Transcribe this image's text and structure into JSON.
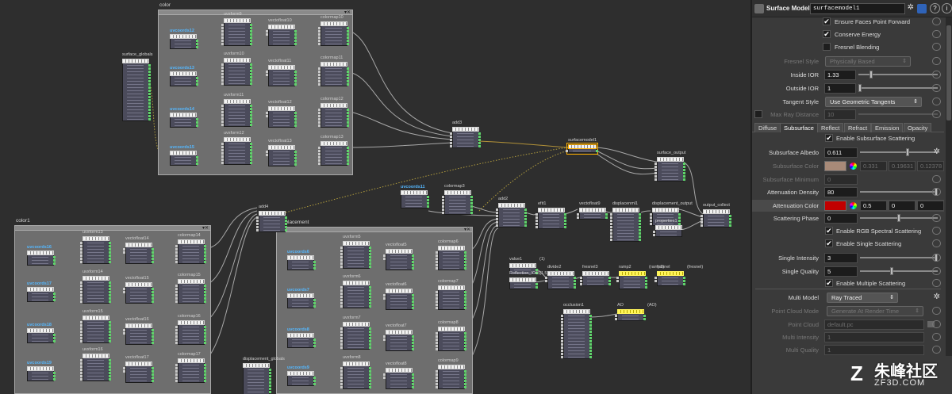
{
  "network": {
    "boxes": {
      "color": "color",
      "color1": "color1",
      "displacement": "Displacement",
      "box_ctl": "▾✕"
    },
    "nodes": {
      "uvcoords12": "uvcoords12",
      "uvxform9": "uvxform9",
      "vectofloat10": "vectofloat10",
      "colormap10": "colormap10",
      "uvcoords13": "uvcoords13",
      "uvxform10": "uvxform10",
      "vectofloat11": "vectofloat11",
      "colormap11": "colormap11",
      "uvcoords14": "uvcoords14",
      "uvxform11": "uvxform11",
      "vectofloat12": "vectofloat12",
      "colormap12": "colormap12",
      "uvcoords15": "uvcoords15",
      "uvxform12": "uvxform12",
      "vectofloat13": "vectofloat13",
      "colormap13": "colormap13",
      "surface_globals": "surface_globals",
      "add3": "add3",
      "add4": "add4",
      "surfacemodel1": "surfacemodel1",
      "surface_output": "surface_output",
      "uvcoords11": "uvcoords11",
      "colormap3": "colormap3",
      "add2": "add2",
      "efit1": "efit1",
      "vectofloat9": "vectofloat9",
      "displacenml1": "displacenml1",
      "displacement_output": "displacement_output",
      "properties1": "properties1",
      "output_collect": "output_collect",
      "value1": "value1",
      "value1_tag": "(1)",
      "refl": "Reflection_IOR1",
      "refl_tag": "(1.5)",
      "divide2": "divide2",
      "fresnel3": "fresnel3",
      "ramp2": "ramp2",
      "ramp2_tag": "(ramp2)",
      "fresnel": "fresnel",
      "fresnel_tag": "(fresnel)",
      "occlusion1": "occlusion1",
      "ao": "AO",
      "ao_tag": "(AO)",
      "uvcoords16": "uvcoords16",
      "uvxform13": "uvxform13",
      "vectofloat14": "vectofloat14",
      "colormap14": "colormap14",
      "uvcoords17": "uvcoords17",
      "uvxform14": "uvxform14",
      "vectofloat15": "vectofloat15",
      "colormap15": "colormap15",
      "uvcoords18": "uvcoords18",
      "uvxform15": "uvxform15",
      "vectofloat16": "vectofloat16",
      "colormap16": "colormap16",
      "uvcoords19": "uvcoords19",
      "uvxform16": "uvxform16",
      "vectofloat17": "vectofloat17",
      "colormap17": "colormap17",
      "uvcoords6": "uvcoords6",
      "uvxform5": "uvxform5",
      "vectofloat5": "vectofloat5",
      "colormap6": "colormap6",
      "uvcoords7": "uvcoords7",
      "uvxform6": "uvxform6",
      "vectofloat6": "vectofloat6",
      "colormap7": "colormap7",
      "uvcoords8": "uvcoords8",
      "uvxform7": "uvxform7",
      "vectofloat7": "vectofloat7",
      "colormap8": "colormap8",
      "uvcoords9": "uvcoords9",
      "uvxform8": "uvxform8",
      "vectofloat8": "vectofloat8",
      "colormap9": "colormap9",
      "displacement_globals": "displacement_globals"
    }
  },
  "panel": {
    "header": {
      "title": "Surface Model",
      "name": "surfacemodel1",
      "help": "?",
      "info": "i"
    },
    "ensure_faces": "Ensure Faces Point Forward",
    "conserve_energy": "Conserve Energy",
    "fresnel_blending": "Fresnel Blending",
    "fresnel_style": {
      "label": "Fresnel Style",
      "value": "Physically Based"
    },
    "inside_ior": {
      "label": "Inside IOR",
      "value": "1.33"
    },
    "outside_ior": {
      "label": "Outside IOR",
      "value": "1"
    },
    "tangent_style": {
      "label": "Tangent Style",
      "value": "Use Geometric Tangents"
    },
    "max_ray": {
      "label": "Max Ray Distance",
      "value": "10"
    },
    "tabs": [
      "Diffuse",
      "Subsurface",
      "Reflect",
      "Refract",
      "Emission",
      "Opacity"
    ],
    "enable_sss": "Enable Subsurface Scattering",
    "sss_albedo": {
      "label": "Subsurface Albedo",
      "value": "0.611"
    },
    "sss_color": {
      "label": "Subsurface Color",
      "r": "0.331",
      "g": "0.19631",
      "b": "0.12378"
    },
    "sss_min": {
      "label": "Subsurface Minimum",
      "value": "0"
    },
    "att_density": {
      "label": "Attenuation Density",
      "value": "80"
    },
    "att_color": {
      "label": "Attenuation Color",
      "r": "0.5",
      "g": "0",
      "b": "0"
    },
    "scatter_phase": {
      "label": "Scattering Phase",
      "value": "0"
    },
    "rgb_spectral": "Enable RGB Spectral Scattering",
    "single_scatter": "Enable Single Scattering",
    "single_intensity": {
      "label": "Single Intensity",
      "value": "3"
    },
    "single_quality": {
      "label": "Single Quality",
      "value": "5"
    },
    "multi_scatter": "Enable Multiple Scattering",
    "multi_model": {
      "label": "Multi Model",
      "value": "Ray Traced"
    },
    "point_cloud_mode": {
      "label": "Point Cloud Mode",
      "value": "Generate At Render Time"
    },
    "point_cloud": {
      "label": "Point Cloud",
      "value": "default.pc"
    },
    "multi_intensity": {
      "label": "Multi Intensity",
      "value": "1"
    },
    "multi_quality": {
      "label": "Multi Quality",
      "value": "1"
    },
    "colors": {
      "sss_swatch": "#a88a78",
      "att_swatch": "#c20000"
    }
  },
  "watermark": {
    "title": "朱峰社区",
    "url": "ZF3D.COM",
    "logo": "Z"
  }
}
